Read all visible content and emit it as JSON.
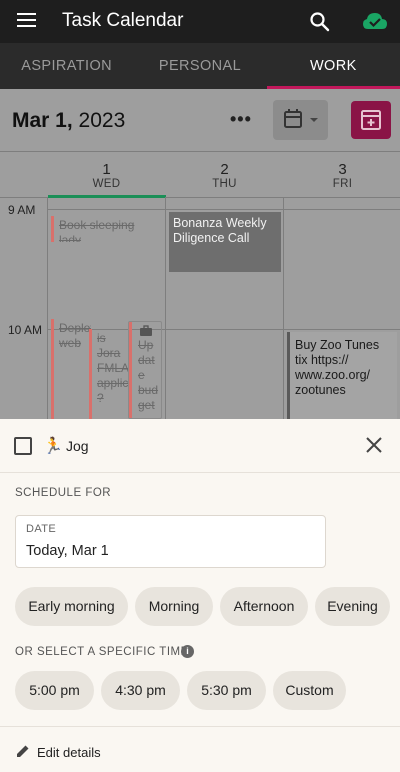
{
  "appbar": {
    "title": "Task Calendar"
  },
  "tabs": [
    {
      "label": "ASPIRATION",
      "active": false
    },
    {
      "label": "PERSONAL",
      "active": false
    },
    {
      "label": "WORK",
      "active": true
    }
  ],
  "calendar": {
    "date_bold": "Mar 1,",
    "date_year": " 2023",
    "more_label": "•••",
    "days": [
      {
        "num": "1",
        "dow": "WED"
      },
      {
        "num": "2",
        "dow": "THU"
      },
      {
        "num": "3",
        "dow": "FRI"
      }
    ],
    "hours": [
      "9 AM",
      "10 AM"
    ],
    "events": {
      "book": "Book sleeping lady",
      "bonanza": "Bonanza Weekly Diligence Call",
      "deploy": "Deploy web",
      "jora": "is Jora FMLA applic ?",
      "update": "Up dat e bud get",
      "zoo": "Buy Zoo Tunes tix https:// www.zoo.org/ zootunes"
    }
  },
  "sheet": {
    "task_icon": "🏃",
    "task_name": "Jog",
    "schedule_label": "SCHEDULE FOR",
    "date_field_label": "DATE",
    "date_field_value": "Today, Mar 1",
    "periods": [
      "Early morning",
      "Morning",
      "Afternoon",
      "Evening"
    ],
    "specific_label": "OR SELECT A SPECIFIC TIME",
    "times": [
      "5:00 pm",
      "4:30 pm",
      "5:30 pm",
      "Custom"
    ],
    "edit_label": "Edit details"
  }
}
